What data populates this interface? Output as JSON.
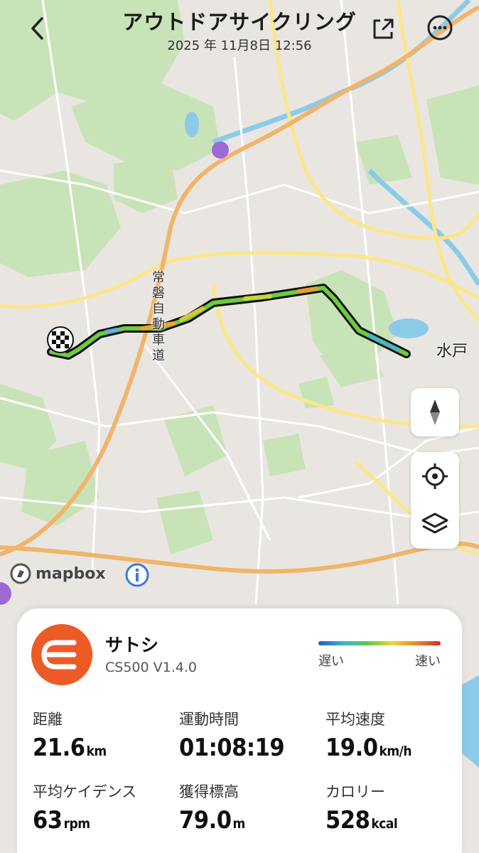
{
  "header": {
    "title": "アウトドアサイクリング",
    "datetime": "2025 年 11月8日 12:56"
  },
  "map": {
    "city_label": "水戸",
    "highway_label": "常磐自動車道",
    "attribution": "mapbox",
    "colors": {
      "land": "#e9e6e1",
      "green": "#c9e3b8",
      "water": "#8ccbe8",
      "highway": "#f2b36a",
      "road": "#fbe68a"
    }
  },
  "card": {
    "user_name": "サトシ",
    "device": "CS500  V1.4.0",
    "legend": {
      "slow": "遅い",
      "fast": "速い"
    },
    "stats": [
      {
        "label": "距離",
        "value": "21.6",
        "unit": "km"
      },
      {
        "label": "運動時間",
        "value": "01:08:19",
        "unit": ""
      },
      {
        "label": "平均速度",
        "value": "19.0",
        "unit": "km/h"
      },
      {
        "label": "平均ケイデンス",
        "value": "63",
        "unit": "rpm"
      },
      {
        "label": "獲得標高",
        "value": "79.0",
        "unit": "m"
      },
      {
        "label": "カロリー",
        "value": "528",
        "unit": "kcal"
      }
    ],
    "accent": "#ec5b25"
  },
  "icons": [
    "back-arrow-icon",
    "share-icon",
    "more-icon",
    "compass-icon",
    "locate-icon",
    "layers-icon",
    "info-icon",
    "finish-flag-icon"
  ]
}
